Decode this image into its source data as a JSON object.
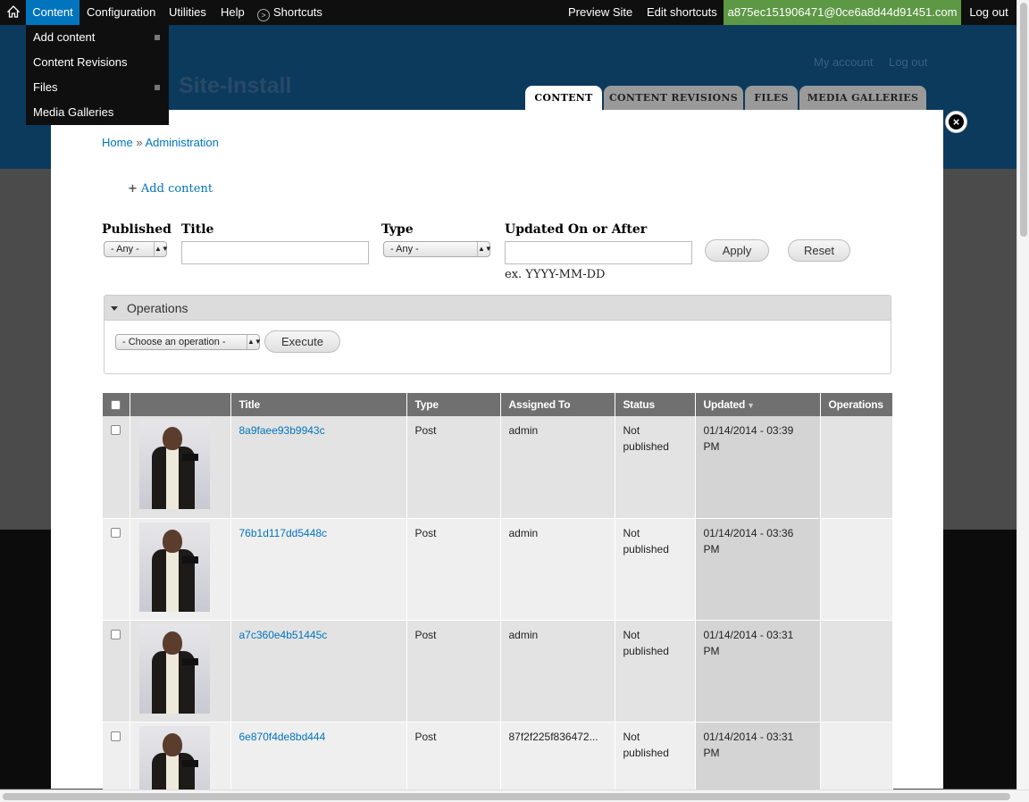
{
  "toolbar": {
    "content": "Content",
    "configuration": "Configuration",
    "utilities": "Utilities",
    "help": "Help",
    "shortcuts": "Shortcuts",
    "preview_site": "Preview Site",
    "edit_shortcuts": "Edit shortcuts",
    "user": "a875ec151906471@0ce6a8d44d91451.com",
    "logout": "Log out"
  },
  "content_menu": [
    {
      "label": "Add content",
      "has_children": true
    },
    {
      "label": "Content Revisions",
      "has_children": false
    },
    {
      "label": "Files",
      "has_children": true
    },
    {
      "label": "Media Galleries",
      "has_children": false
    }
  ],
  "header": {
    "site_name": "Site-Install",
    "my_account": "My account",
    "logout": "Log out"
  },
  "tabs": [
    "CONTENT",
    "CONTENT REVISIONS",
    "FILES",
    "MEDIA GALLERIES"
  ],
  "breadcrumb": {
    "home": "Home",
    "separator": "»",
    "admin": "Administration"
  },
  "add_content": "Add content",
  "filters": {
    "published_label": "Published",
    "published_value": "- Any -",
    "title_label": "Title",
    "title_value": "",
    "type_label": "Type",
    "type_value": "- Any -",
    "updated_label": "Updated On or After",
    "updated_value": "",
    "updated_hint": "ex. YYYY-MM-DD",
    "apply": "Apply",
    "reset": "Reset"
  },
  "operations": {
    "legend": "Operations",
    "select_value": "- Choose an operation -",
    "execute": "Execute"
  },
  "table": {
    "headers": [
      "Title",
      "Type",
      "Assigned To",
      "Status",
      "Updated",
      "Operations"
    ],
    "sorted_column": "Updated",
    "rows": [
      {
        "title": "8a9faee93b9943c",
        "type": "Post",
        "assigned": "admin",
        "status_1": "Not",
        "status_2": "published",
        "updated_1": "01/14/2014 - 03:39",
        "updated_2": "PM"
      },
      {
        "title": "76b1d117dd5448c",
        "type": "Post",
        "assigned": "admin",
        "status_1": "Not",
        "status_2": "published",
        "updated_1": "01/14/2014 - 03:36",
        "updated_2": "PM"
      },
      {
        "title": "a7c360e4b51445c",
        "type": "Post",
        "assigned": "admin",
        "status_1": "Not",
        "status_2": "published",
        "updated_1": "01/14/2014 - 03:31",
        "updated_2": "PM"
      },
      {
        "title": "6e870f4de8bd444",
        "type": "Post",
        "assigned": "87f2f225f836472...",
        "status_1": "Not",
        "status_2": "published",
        "updated_1": "01/14/2014 - 03:31",
        "updated_2": "PM"
      }
    ]
  },
  "icons": {
    "home": "home-icon",
    "shortcuts": "shortcuts-circle-icon",
    "close": "close-icon",
    "sort": "sort-desc-icon"
  },
  "colors": {
    "toolbar_bg": "#0f0f0f",
    "active_menu": "#0074bd",
    "user_badge": "#5d9845",
    "header_bg": "#0b3a5d",
    "link": "#0074bd",
    "table_header": "#707070"
  }
}
